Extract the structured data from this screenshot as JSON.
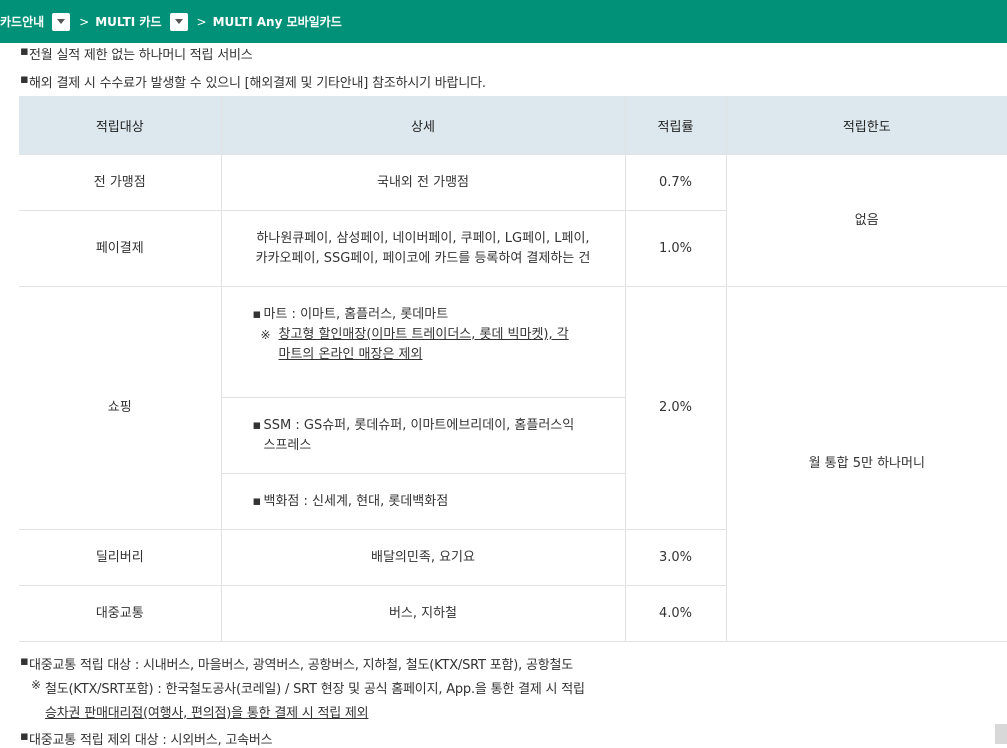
{
  "breadcrumb": {
    "items": [
      "카드안내",
      "MULTI 카드",
      "MULTI Any 모바일카드"
    ],
    "separator": ">"
  },
  "top_notes": [
    "전월 실적 제한 없는 하나머니 적립 서비스",
    "해외 결제 시 수수료가 발생할 수 있으니 [해외결제 및 기타안내] 참조하시기 바랍니다."
  ],
  "bullet": "▪",
  "table": {
    "headers": [
      "적립대상",
      "상세",
      "적립률",
      "적립한도"
    ],
    "rows": {
      "all_stores": {
        "target": "전 가맹점",
        "detail": "국내외 전 가맹점",
        "rate": "0.7%"
      },
      "pay": {
        "target": "페이결제",
        "detail_line1": "하나원큐페이, 삼성페이, 네이버페이, 쿠페이, LG페이, L페이,",
        "detail_line2": "카카오페이, SSG페이, 페이코에 카드를 등록하여 결제하는 건",
        "rate": "1.0%"
      },
      "limit_top": "없음",
      "shopping": {
        "target": "쇼핑",
        "rate": "2.0%",
        "mart": "마트 : 이마트, 홈플러스, 롯데마트",
        "mart_note_mark": "※",
        "mart_note_line1": "창고형 할인매장(이마트 트레이더스, 롯데 빅마켓), 각",
        "mart_note_line2": "마트의 온라인 매장은 제외",
        "ssm_line1": "SSM : GS슈퍼, 롯데슈퍼, 이마트에브리데이, 홈플러스익",
        "ssm_line2": "스프레스",
        "dept": "백화점 : 신세계, 현대, 롯데백화점"
      },
      "limit_bottom": "월 통합 5만 하나머니",
      "delivery": {
        "target": "딜리버리",
        "detail": "배달의민족, 요기요",
        "rate": "3.0%"
      },
      "transit": {
        "target": "대중교통",
        "detail": "버스, 지하철",
        "rate": "4.0%"
      }
    }
  },
  "bottom_notes": {
    "line1": "대중교통 적립 대상 : 시내버스, 마을버스, 광역버스, 공항버스, 지하철, 철도(KTX/SRT 포함), 공항철도",
    "mark": "※",
    "line2": "철도(KTX/SRT포함) : 한국철도공사(코레일) / SRT 현장 및 공식 홈페이지, App.을 통한 결제 시 적립",
    "line3": "승차권 판매대리점(여행사, 편의점)을 통한 결제 시 적립 제외",
    "line4": "대중교통 적립 제외 대상 : 시외버스, 고속버스"
  },
  "colors": {
    "topbar": "#009178",
    "table_header": "#dde8ee",
    "border": "#e2e2e2"
  }
}
